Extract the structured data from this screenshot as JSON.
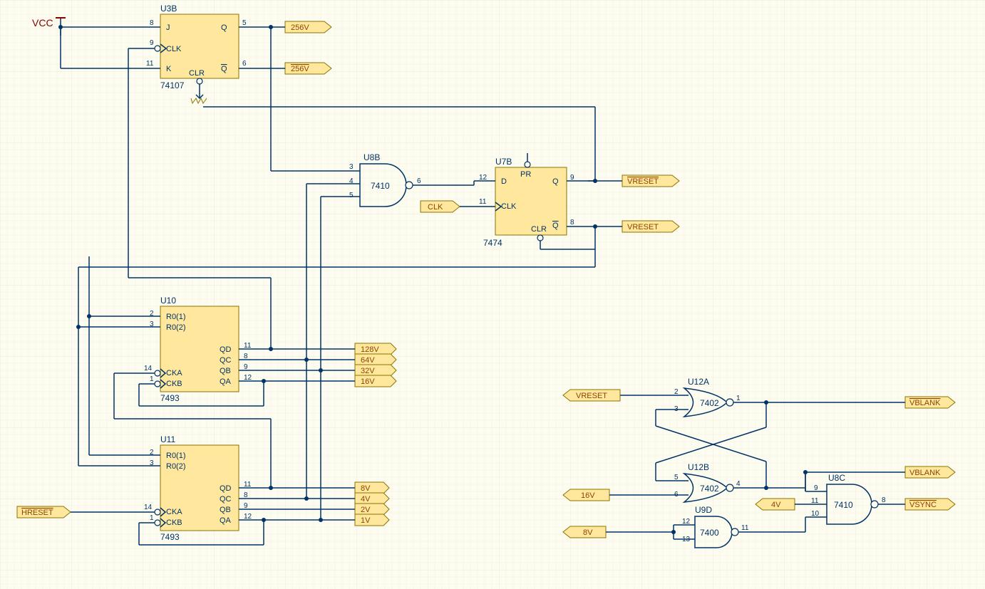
{
  "power": {
    "vcc": "VCC"
  },
  "components": {
    "U3B": {
      "ref": "U3B",
      "val": "74107",
      "pins": {
        "J": "J",
        "CLK": "CLK",
        "K": "K",
        "CLR": "CLR",
        "Q": "Q",
        "Qn": "Q"
      },
      "nums": {
        "J": "8",
        "CLK": "9",
        "K": "11",
        "Q": "5",
        "Qn": "6"
      }
    },
    "U8B": {
      "ref": "U8B",
      "val": "7410",
      "nums": {
        "a": "3",
        "b": "4",
        "c": "5",
        "y": "6"
      }
    },
    "U7B": {
      "ref": "U7B",
      "val": "7474",
      "pins": {
        "D": "D",
        "PR": "PR",
        "CLK": "CLK",
        "CLR": "CLR",
        "Q": "Q",
        "Qn": "Q"
      },
      "nums": {
        "D": "12",
        "CLK": "11",
        "Q": "9",
        "Qn": "8"
      }
    },
    "U10": {
      "ref": "U10",
      "val": "7493",
      "pins": {
        "R01": "R0(1)",
        "R02": "R0(2)",
        "CKA": "CKA",
        "CKB": "CKB",
        "QA": "QA",
        "QB": "QB",
        "QC": "QC",
        "QD": "QD"
      },
      "nums": {
        "R01": "2",
        "R02": "3",
        "CKA": "14",
        "CKB": "1",
        "QD": "11",
        "QC": "8",
        "QB": "9",
        "QA": "12"
      }
    },
    "U11": {
      "ref": "U11",
      "val": "7493",
      "pins": {
        "R01": "R0(1)",
        "R02": "R0(2)",
        "CKA": "CKA",
        "CKB": "CKB",
        "QA": "QA",
        "QB": "QB",
        "QC": "QC",
        "QD": "QD"
      },
      "nums": {
        "R01": "2",
        "R02": "3",
        "CKA": "14",
        "CKB": "1",
        "QD": "11",
        "QC": "8",
        "QB": "9",
        "QA": "12"
      }
    },
    "U12A": {
      "ref": "U12A",
      "val": "7402",
      "nums": {
        "a": "2",
        "b": "3",
        "y": "1"
      }
    },
    "U12B": {
      "ref": "U12B",
      "val": "7402",
      "nums": {
        "a": "5",
        "b": "6",
        "y": "4"
      }
    },
    "U9D": {
      "ref": "U9D",
      "val": "7400",
      "nums": {
        "a": "12",
        "b": "13",
        "y": "11"
      }
    },
    "U8C": {
      "ref": "U8C",
      "val": "7410",
      "nums": {
        "a": "9",
        "b": "11",
        "c": "10",
        "y": "8"
      }
    }
  },
  "ports": {
    "p256V": "256V",
    "p256Vn": "256V",
    "clk": "CLK",
    "vreset": "VRESET",
    "vresetn": "VRESET",
    "v128": "128V",
    "v64": "64V",
    "v32": "32V",
    "v16": "16V",
    "v8": "8V",
    "v4": "4V",
    "v2": "2V",
    "v1": "1V",
    "hresetn": "HRESET",
    "vblankn": "VBLANK",
    "vblank": "VBLANK",
    "vsyncn": "VSYNC",
    "p16V": "16V",
    "p8V": "8V",
    "p4V": "4V",
    "pvreset": "VRESET"
  }
}
